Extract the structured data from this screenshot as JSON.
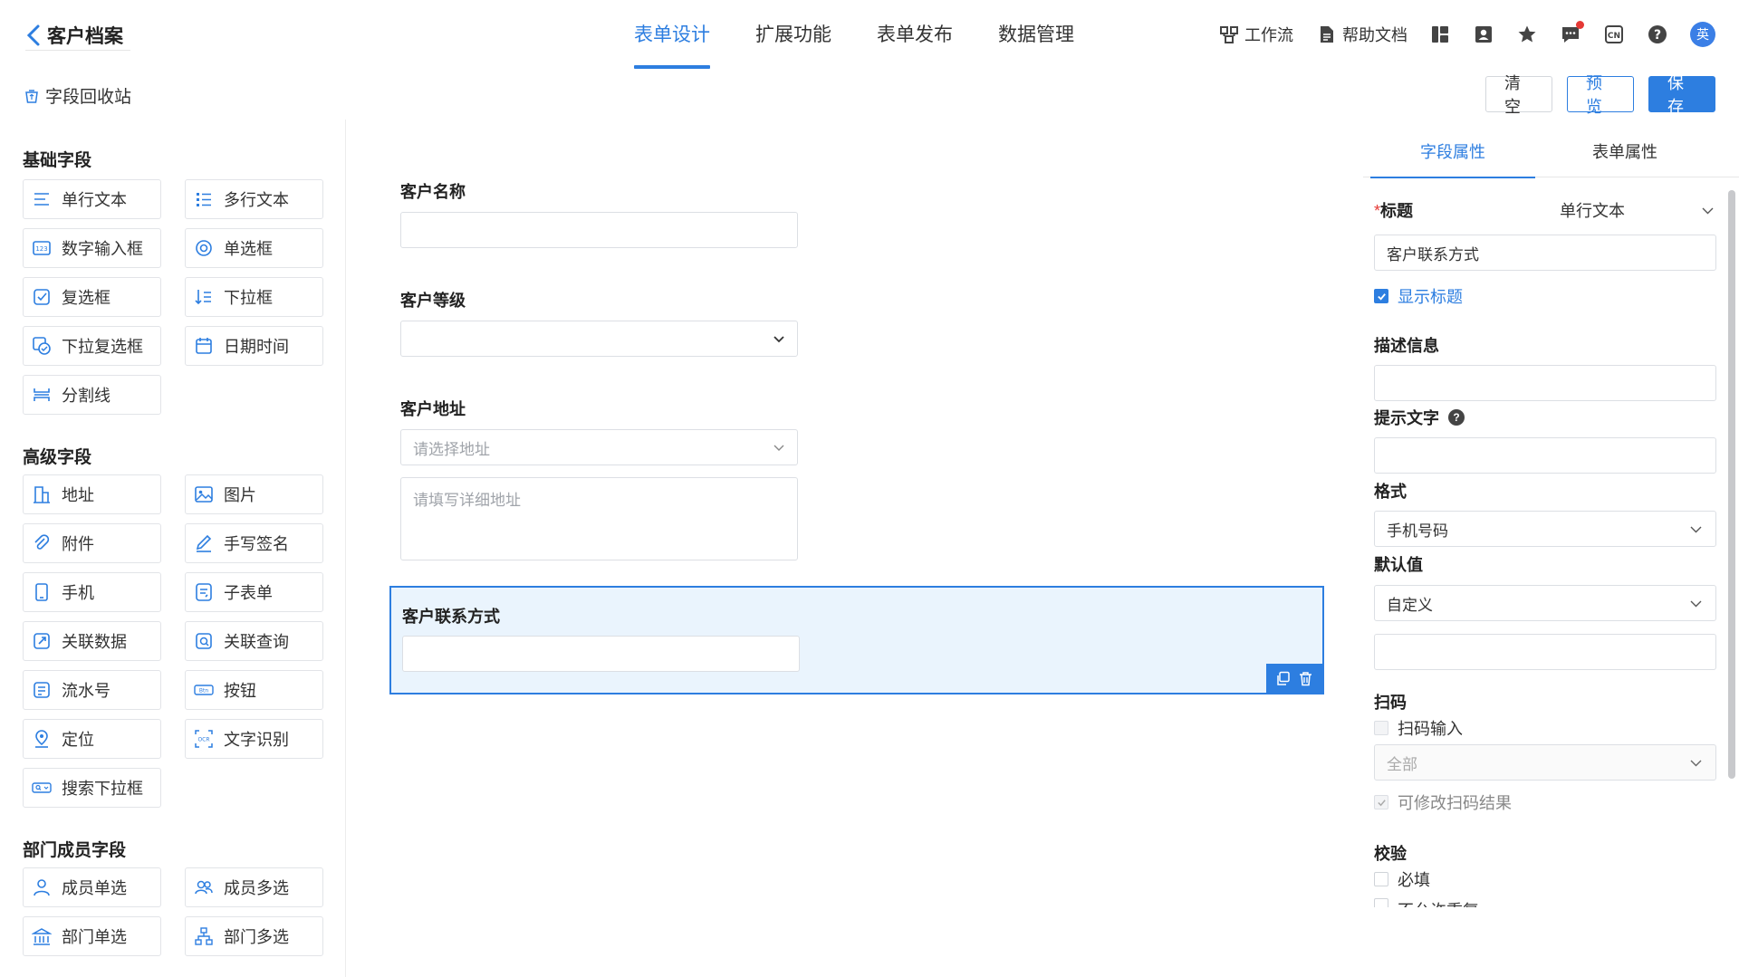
{
  "header": {
    "back_title": "客户档案",
    "tabs": [
      {
        "label": "表单设计",
        "active": true
      },
      {
        "label": "扩展功能"
      },
      {
        "label": "表单发布"
      },
      {
        "label": "数据管理"
      }
    ],
    "workflow_label": "工作流",
    "help_label": "帮助文档",
    "avatar_text": "英"
  },
  "subbar": {
    "recycle_label": "字段回收站",
    "clear_label": "清空",
    "preview_label": "预览",
    "save_label": "保存"
  },
  "left": {
    "sections": [
      {
        "title": "基础字段",
        "items": [
          "单行文本",
          "多行文本",
          "数字输入框",
          "单选框",
          "复选框",
          "下拉框",
          "下拉复选框",
          "日期时间",
          "分割线"
        ]
      },
      {
        "title": "高级字段",
        "items": [
          "地址",
          "图片",
          "附件",
          "手写签名",
          "手机",
          "子表单",
          "关联数据",
          "关联查询",
          "流水号",
          "按钮",
          "定位",
          "文字识别",
          "搜索下拉框"
        ]
      },
      {
        "title": "部门成员字段",
        "items": [
          "成员单选",
          "成员多选",
          "部门单选",
          "部门多选"
        ]
      }
    ]
  },
  "canvas": {
    "fields": [
      {
        "label": "客户名称"
      },
      {
        "label": "客户等级"
      },
      {
        "label": "客户地址",
        "address_placeholder": "请选择地址",
        "detail_placeholder": "请填写详细地址"
      },
      {
        "label": "客户联系方式"
      }
    ]
  },
  "right": {
    "tabs": [
      "字段属性",
      "表单属性"
    ],
    "title_label": "标题",
    "field_type": "单行文本",
    "title_value": "客户联系方式",
    "show_title_label": "显示标题",
    "desc_label": "描述信息",
    "hint_label": "提示文字",
    "format_label": "格式",
    "format_value": "手机号码",
    "default_label": "默认值",
    "default_value": "自定义",
    "scan_label": "扫码",
    "scan_input_label": "扫码输入",
    "scan_scope_value": "全部",
    "scan_editable_label": "可修改扫码结果",
    "validate_label": "校验",
    "required_label": "必填",
    "unique_label": "不允许重复"
  },
  "colors": {
    "accent": "#2d7ee0",
    "selected_bg": "#eaf4fd",
    "badge_red": "#e53935"
  }
}
